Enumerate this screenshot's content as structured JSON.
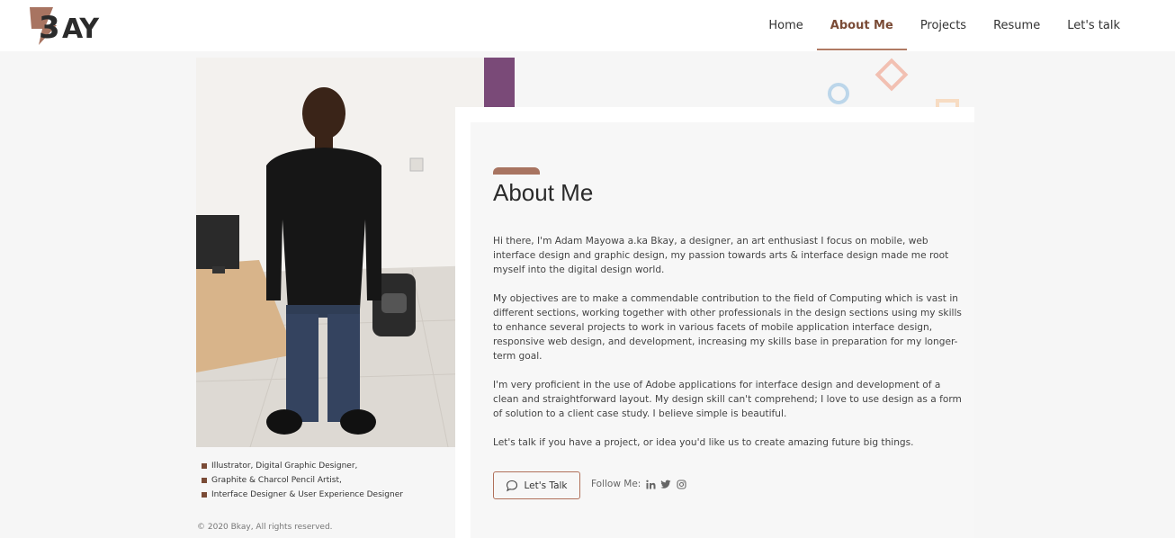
{
  "header": {
    "logo_text": "BKAY",
    "nav": [
      {
        "label": "Home"
      },
      {
        "label": "About Me"
      },
      {
        "label": "Projects"
      },
      {
        "label": "Resume"
      },
      {
        "label": "Let's talk"
      }
    ]
  },
  "sidebar": {
    "skills": [
      "Illustrator, Digital Graphic Designer,",
      "Graphite & Charcol Pencil Artist,",
      "Interface Designer & User Experience Designer"
    ],
    "copyright": "© 2020 Bkay, All rights reserved."
  },
  "about": {
    "title": "About Me",
    "paragraphs": [
      "Hi there, I'm Adam Mayowa a.ka Bkay, a designer, an art enthusiast I focus on mobile, web interface design and graphic design, my passion towards arts & interface design made me root myself into the digital design world.",
      "My objectives are to make a commendable contribution to the field of Computing which is vast in different sections, working together with other professionals in the design sections using my skills to enhance several projects to work in various facets of mobile application interface design, responsive web design, and development, increasing my skills base in preparation for my longer-term goal.",
      "I'm very proficient in the use of Adobe applications for interface design and development of a clean and straightforward layout. My design skill can't comprehend; I love to use design as a form of solution to a client case study. I believe simple is beautiful.",
      "Let's talk if you have a project, or idea you'd like us to create amazing future big things."
    ],
    "talk_button": "Let's Talk",
    "follow_label": "Follow Me:",
    "socials": [
      "linkedin-icon",
      "twitter-icon",
      "instagram-icon"
    ]
  },
  "colors": {
    "accent": "#a87461",
    "nav_active": "#7a4b36",
    "background": "#f6f6f6"
  }
}
